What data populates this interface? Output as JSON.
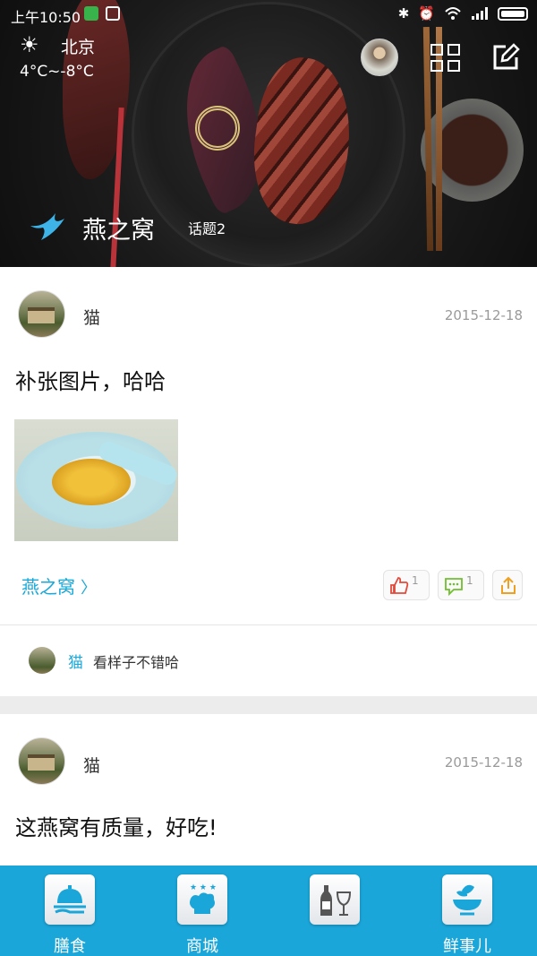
{
  "status_bar": {
    "time": "上午10:50"
  },
  "weather": {
    "city": "北京",
    "temperature": "4°C~-8°C"
  },
  "header": {
    "brand_name": "燕之窝",
    "topic_count": "话题2"
  },
  "posts": [
    {
      "username": "猫",
      "date": "2015-12-18",
      "content": "补张图片，哈哈",
      "topic_link": "燕之窝",
      "likes": "1",
      "comments": "1",
      "comment_items": [
        {
          "name": "猫",
          "text": "看样子不错哈"
        }
      ]
    },
    {
      "username": "猫",
      "date": "2015-12-18",
      "content": "这燕窝有质量，好吃!"
    }
  ],
  "bottom_nav": {
    "items": [
      {
        "label": "膳食",
        "icon": "cloche-icon"
      },
      {
        "label": "商城",
        "icon": "chef-hat-icon"
      },
      {
        "label": "",
        "icon": "wine-icon"
      },
      {
        "label": "鲜事儿",
        "icon": "tea-bowl-icon"
      }
    ]
  },
  "colors": {
    "accent": "#1ba6d9",
    "link": "#1aa8d8"
  }
}
